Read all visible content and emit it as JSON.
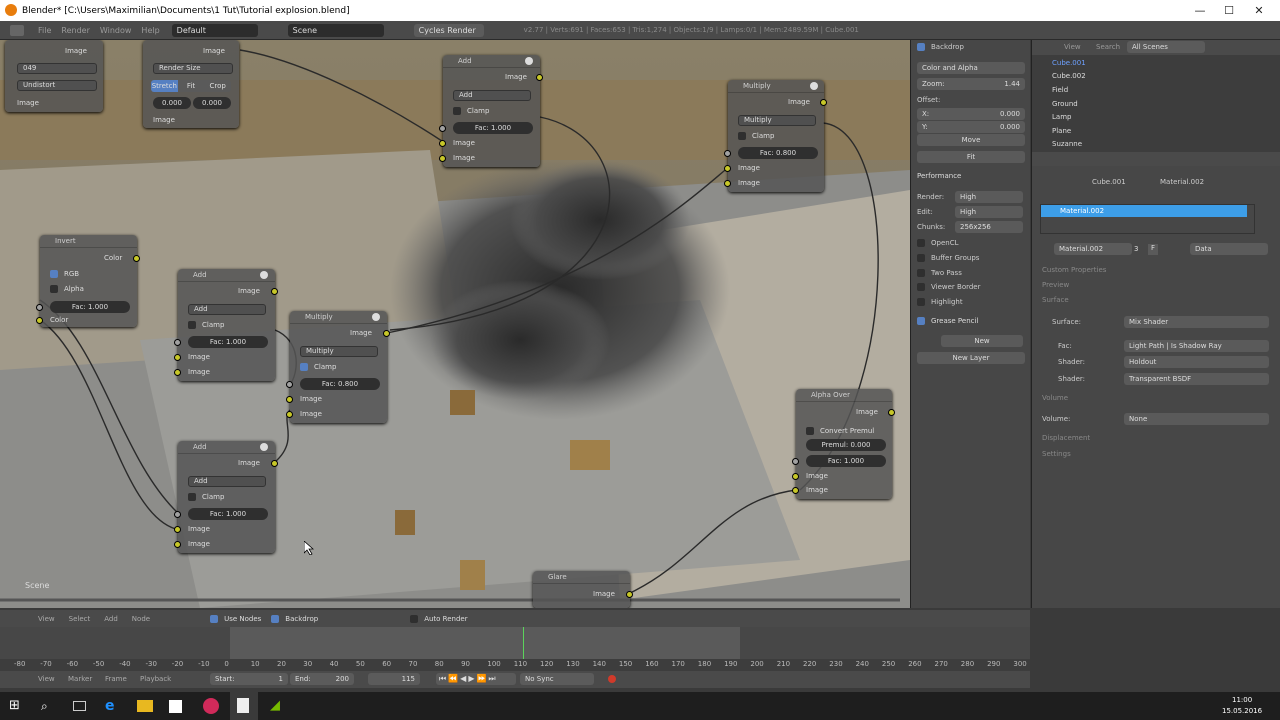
{
  "window": {
    "title": "Blender* [C:\\Users\\Maximilian\\Documents\\1 Tut\\Tutorial explosion.blend]",
    "min": "—",
    "max": "☐",
    "close": "✕"
  },
  "menubar": {
    "menus": [
      "File",
      "Render",
      "Window",
      "Help"
    ],
    "layout": "Default",
    "scene": "Scene",
    "engine": "Cycles Render",
    "stats": "v2.77 | Verts:691 | Faces:653 | Tris:1,274 | Objects:1/9 | Lamps:0/1 | Mem:2489.59M | Cube.001"
  },
  "nodes": {
    "top_left": {
      "image": "Image",
      "frame": "049",
      "undistort": "Undistort",
      "image2": "Image"
    },
    "scale": {
      "image": "Image",
      "render_size": "Render Size",
      "stretch": "Stretch",
      "fit": "Fit",
      "crop": "Crop",
      "v1": "0.000",
      "v2": "0.000",
      "image_out": "Image"
    },
    "add_top": {
      "title": "Add",
      "out": "Image",
      "op": "Add",
      "clamp": "Clamp",
      "fac_label": "Fac:",
      "fac": "1.000",
      "in1": "Image",
      "in2": "Image"
    },
    "multiply_top": {
      "title": "Multiply",
      "out": "Image",
      "op": "Multiply",
      "clamp": "Clamp",
      "fac_label": "Fac:",
      "fac": "0.800",
      "in1": "Image",
      "in2": "Image"
    },
    "invert": {
      "title": "Invert",
      "color_out": "Color",
      "rgb": "RGB",
      "alpha": "Alpha",
      "fac_label": "Fac:",
      "fac": "1.000",
      "color_in": "Color"
    },
    "add_mid": {
      "title": "Add",
      "out": "Image",
      "op": "Add",
      "clamp": "Clamp",
      "fac_label": "Fac:",
      "fac": "1.000",
      "in1": "Image",
      "in2": "Image"
    },
    "multiply_mid": {
      "title": "Multiply",
      "out": "Image",
      "op": "Multiply",
      "clamp": "Clamp",
      "fac_label": "Fac:",
      "fac": "0.800",
      "in1": "Image",
      "in2": "Image"
    },
    "add_bot": {
      "title": "Add",
      "out": "Image",
      "op": "Add",
      "clamp": "Clamp",
      "fac_label": "Fac:",
      "fac": "1.000",
      "in1": "Image",
      "in2": "Image"
    },
    "alpha_over": {
      "title": "Alpha Over",
      "out": "Image",
      "convert": "Convert Premul",
      "premul_label": "Premul:",
      "premul": "0.000",
      "fac_label": "Fac:",
      "fac": "1.000",
      "in1": "Image",
      "in2": "Image"
    },
    "glare": {
      "title": "Glare",
      "out": "Image"
    },
    "scene_label": "Scene"
  },
  "props": {
    "backdrop": "Backdrop",
    "channels": "Color and Alpha",
    "zoom_label": "Zoom:",
    "zoom": "1.44",
    "offset": "Offset:",
    "x_label": "X:",
    "x": "0.000",
    "y_label": "Y:",
    "y": "0.000",
    "move": "Move",
    "fit": "Fit",
    "performance": "Performance",
    "render_label": "Render:",
    "render": "High",
    "edit_label": "Edit:",
    "edit": "High",
    "chunks_label": "Chunks:",
    "chunks": "256x256",
    "opencl": "OpenCL",
    "buffer_groups": "Buffer Groups",
    "two_pass": "Two Pass",
    "viewer_border": "Viewer Border",
    "highlight": "Highlight",
    "grease": "Grease Pencil",
    "new": "New",
    "new_layer": "New Layer"
  },
  "outliner": {
    "view": "View",
    "search": "Search",
    "scenes": "All Scenes",
    "items": [
      "Cube.001",
      "Cube.002",
      "Field",
      "Ground",
      "Lamp",
      "Plane",
      "Suzanne"
    ]
  },
  "material": {
    "obj": "Cube.001",
    "mat": "Material.002",
    "slot": "Material.002",
    "mat_field": "Material.002",
    "users": "3",
    "f": "F",
    "data": "Data",
    "custom": "Custom Properties",
    "preview": "Preview",
    "surface": "Surface",
    "surface_label": "Surface:",
    "surface_val": "Mix Shader",
    "fac_label": "Fac:",
    "fac_val": "Light Path | Is Shadow Ray",
    "shader_label": "Shader:",
    "shader1": "Holdout",
    "shader2": "Transparent BSDF",
    "volume": "Volume",
    "volume_label": "Volume:",
    "volume_val": "None",
    "displacement": "Displacement",
    "settings": "Settings"
  },
  "nodebar": {
    "view": "View",
    "select": "Select",
    "add": "Add",
    "node": "Node",
    "use_nodes": "Use Nodes",
    "backdrop": "Backdrop",
    "auto_render": "Auto Render"
  },
  "timeline": {
    "ticks": [
      "-80",
      "-70",
      "-60",
      "-50",
      "-40",
      "-30",
      "-20",
      "-10",
      "0",
      "10",
      "20",
      "30",
      "40",
      "50",
      "60",
      "70",
      "80",
      "90",
      "100",
      "110",
      "120",
      "130",
      "140",
      "150",
      "160",
      "170",
      "180",
      "190",
      "200",
      "210",
      "220",
      "230",
      "240",
      "250",
      "260",
      "270",
      "280",
      "290",
      "300"
    ]
  },
  "tlbar": {
    "view": "View",
    "marker": "Marker",
    "frame": "Frame",
    "playback": "Playback",
    "start": "Start:",
    "start_v": "1",
    "end": "End:",
    "end_v": "200",
    "current": "115",
    "sync": "No Sync"
  },
  "taskbar": {
    "time": "11:00",
    "date": "15.05.2016"
  }
}
